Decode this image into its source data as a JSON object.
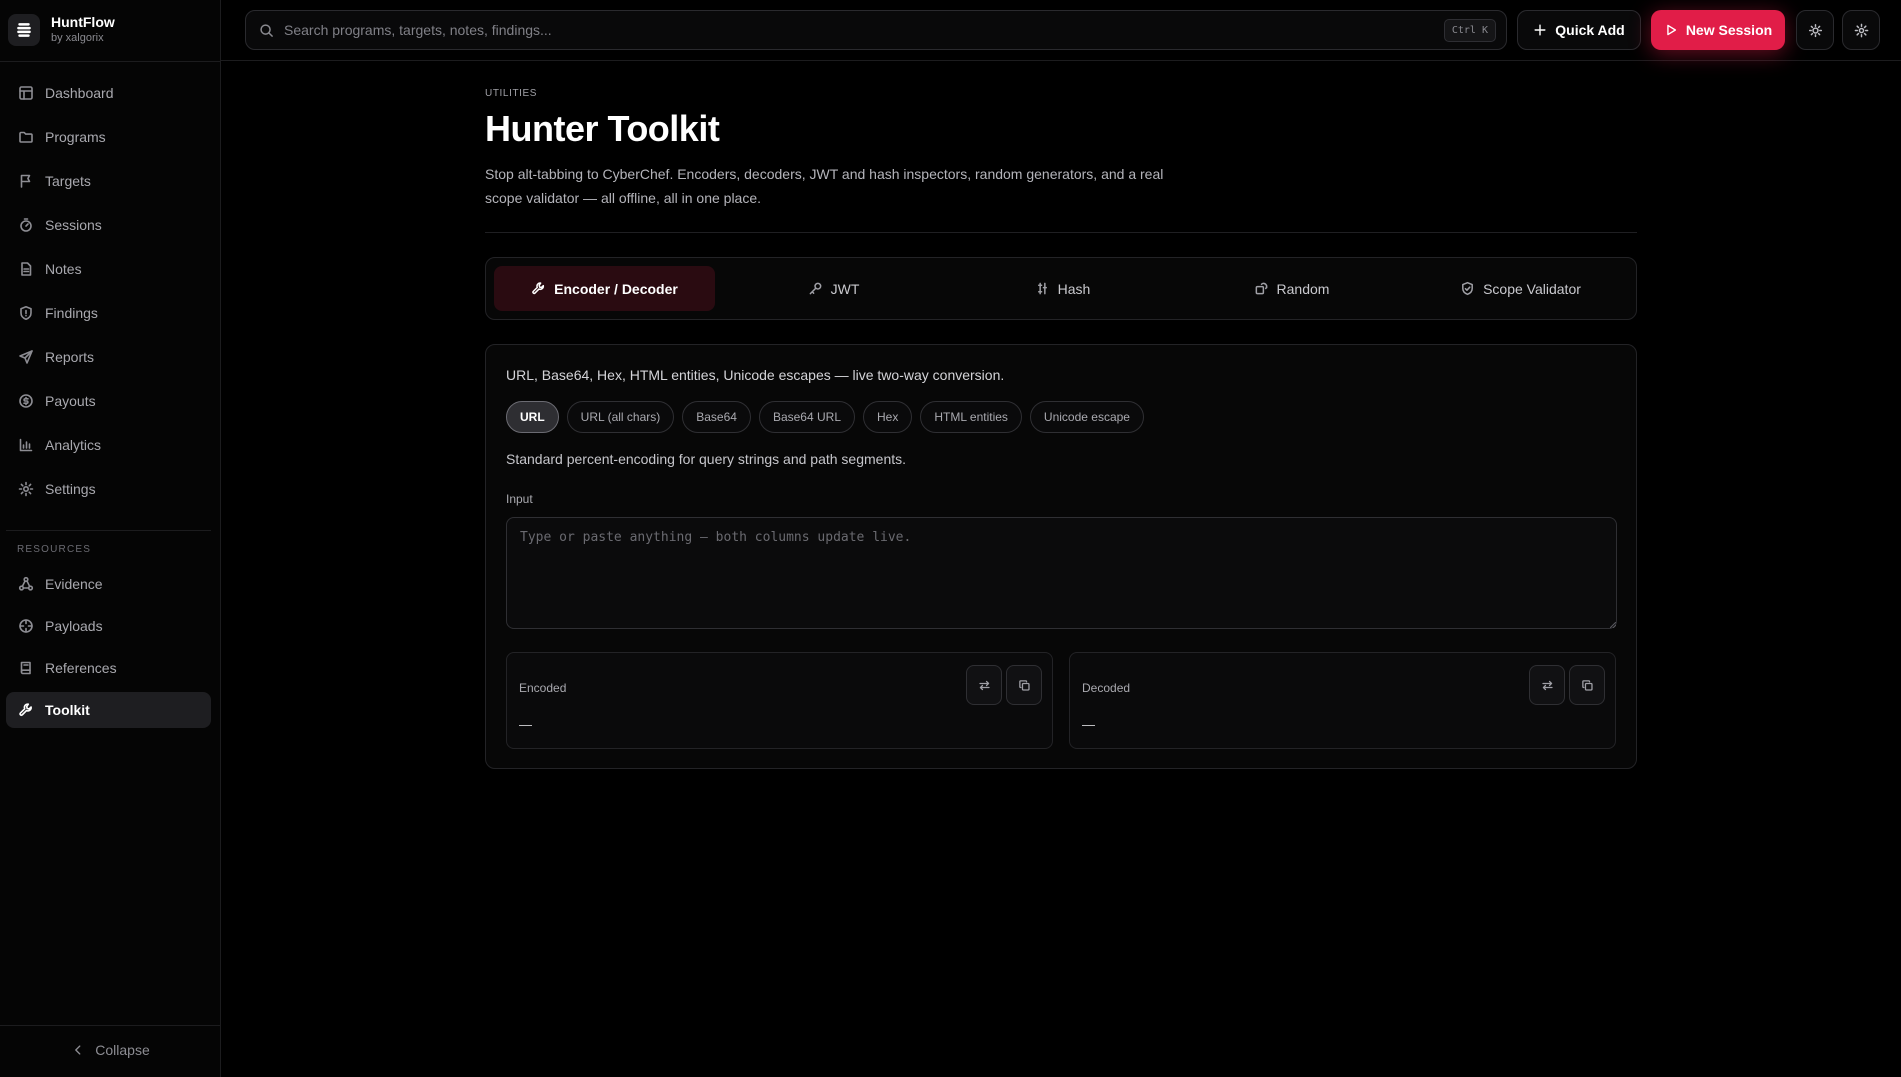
{
  "brand": {
    "name": "HuntFlow",
    "sub": "by xalgorix"
  },
  "nav": {
    "items": [
      {
        "label": "Dashboard",
        "icon": "grid-icon"
      },
      {
        "label": "Programs",
        "icon": "folder-icon"
      },
      {
        "label": "Targets",
        "icon": "flag-icon"
      },
      {
        "label": "Sessions",
        "icon": "timer-icon"
      },
      {
        "label": "Notes",
        "icon": "file-text-icon"
      },
      {
        "label": "Findings",
        "icon": "shield-alert-icon"
      },
      {
        "label": "Reports",
        "icon": "send-icon"
      },
      {
        "label": "Payouts",
        "icon": "dollar-circle-icon"
      },
      {
        "label": "Analytics",
        "icon": "bar-chart-icon"
      },
      {
        "label": "Settings",
        "icon": "gear-icon"
      }
    ],
    "resources_label": "RESOURCES",
    "resources": [
      {
        "label": "Evidence",
        "icon": "network-icon"
      },
      {
        "label": "Payloads",
        "icon": "crosshair-icon"
      },
      {
        "label": "References",
        "icon": "book-icon"
      },
      {
        "label": "Toolkit",
        "icon": "wrench-icon",
        "active": true
      }
    ],
    "collapse_label": "Collapse"
  },
  "topbar": {
    "search_placeholder": "Search programs, targets, notes, findings...",
    "shortcut": "Ctrl K",
    "quick_add_label": "Quick Add",
    "new_session_label": "New Session",
    "accent_color": "#e11d48"
  },
  "page": {
    "eyebrow": "UTILITIES",
    "title": "Hunter Toolkit",
    "description": "Stop alt-tabbing to CyberChef. Encoders, decoders, JWT and hash inspectors, random generators, and a real scope validator — all offline, all in one place."
  },
  "tabs": [
    {
      "label": "Encoder / Decoder",
      "icon": "wrench-icon",
      "active": true
    },
    {
      "label": "JWT",
      "icon": "key-icon"
    },
    {
      "label": "Hash",
      "icon": "hash-icon"
    },
    {
      "label": "Random",
      "icon": "shuffle-icon"
    },
    {
      "label": "Scope Validator",
      "icon": "shield-check-icon"
    }
  ],
  "encoder": {
    "intro": "URL, Base64, Hex, HTML entities, Unicode escapes — live two-way conversion.",
    "modes": [
      "URL",
      "URL (all chars)",
      "Base64",
      "Base64 URL",
      "Hex",
      "HTML entities",
      "Unicode escape"
    ],
    "selected_mode": "URL",
    "mode_note": "Standard percent-encoding for query strings and path segments.",
    "input_label": "Input",
    "input_placeholder": "Type or paste anything — both columns update live.",
    "input_value": "",
    "encoded": {
      "label": "Encoded",
      "value": "—"
    },
    "decoded": {
      "label": "Decoded",
      "value": "—"
    }
  }
}
